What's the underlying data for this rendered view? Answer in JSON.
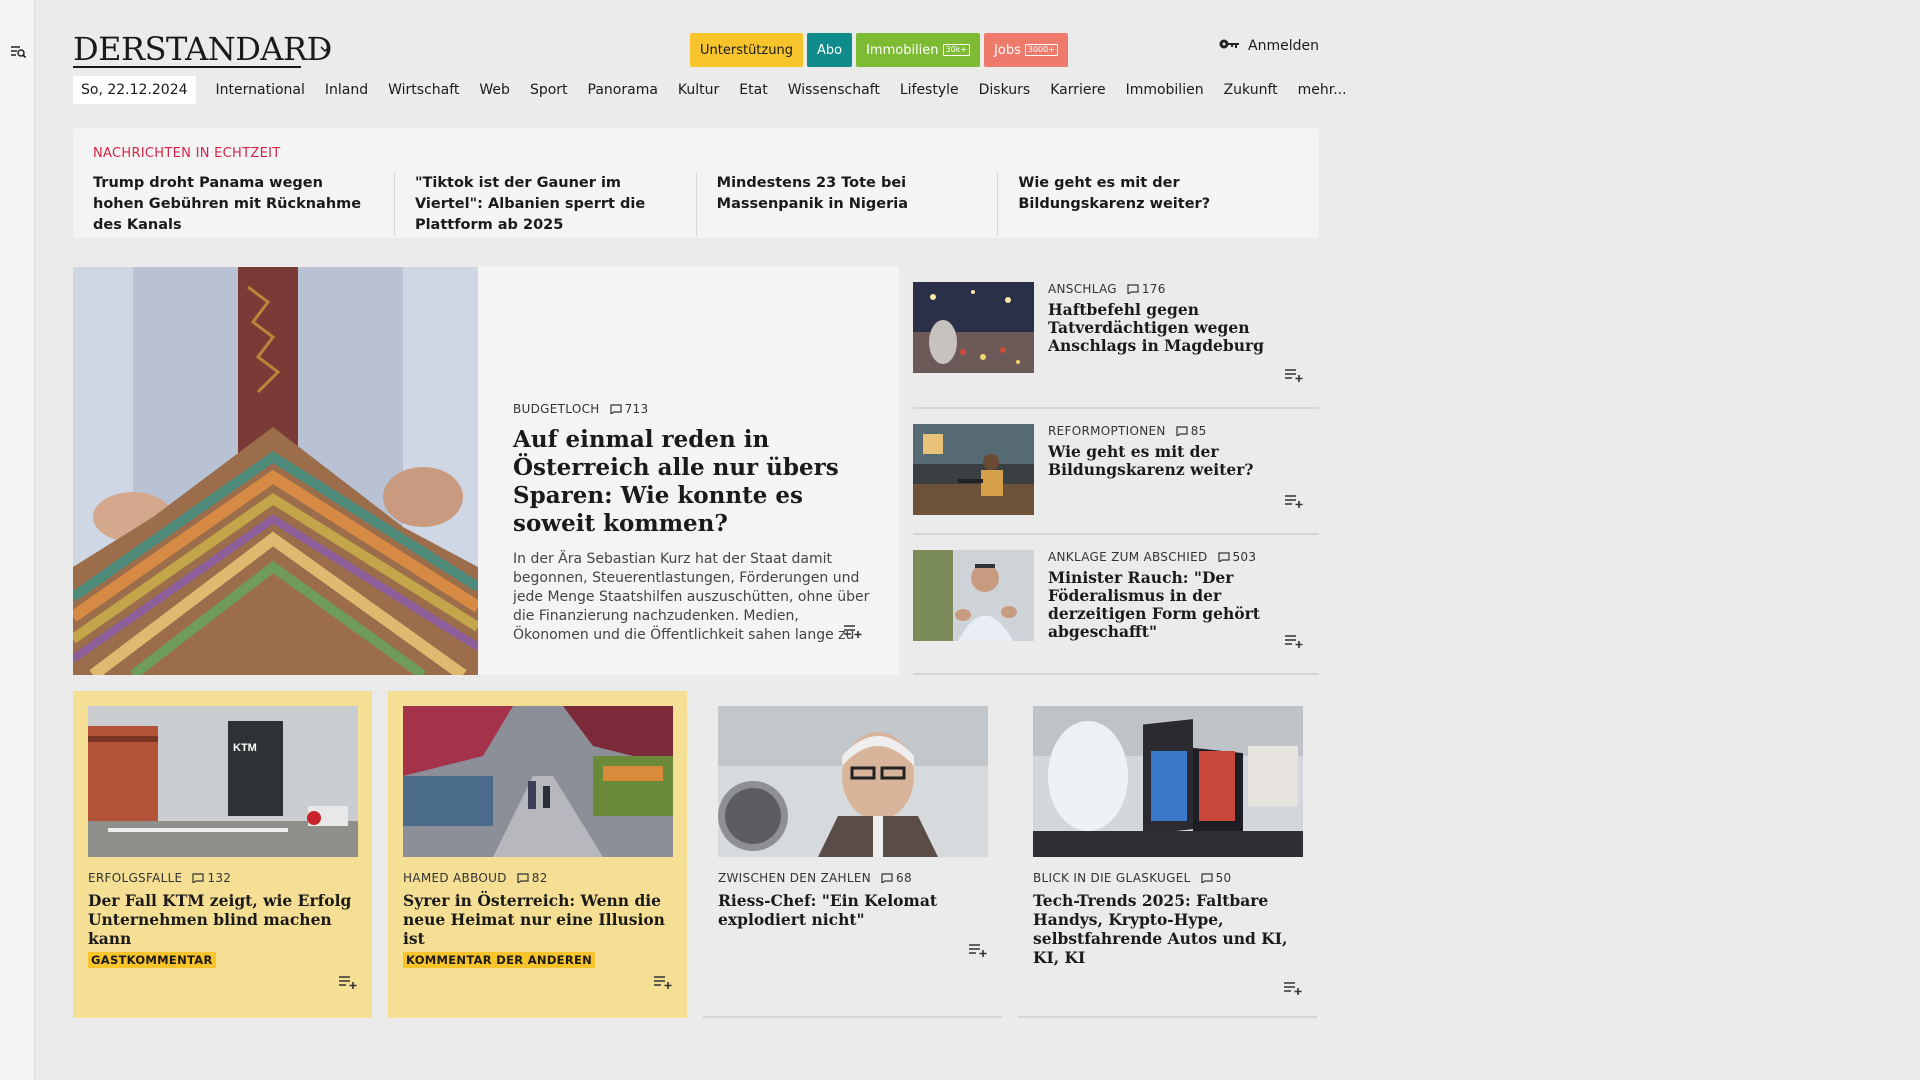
{
  "rail": {
    "icon": "search-menu-icon"
  },
  "header": {
    "logo": "DERSTANDARD",
    "pills": {
      "support": "Unterstützung",
      "abo": "Abo",
      "immo": "Immobilien",
      "immo_badge": "30k+",
      "jobs": "Jobs",
      "jobs_badge": "3000+"
    },
    "login": "Anmelden"
  },
  "nav": {
    "date": "So, 22.12.2024",
    "items": [
      "International",
      "Inland",
      "Wirtschaft",
      "Web",
      "Sport",
      "Panorama",
      "Kultur",
      "Etat",
      "Wissenschaft",
      "Lifestyle",
      "Diskurs",
      "Karriere",
      "Immobilien",
      "Zukunft",
      "mehr..."
    ]
  },
  "ticker": {
    "label": "NACHRICHTEN IN ECHTZEIT",
    "items": [
      "Trump droht Panama wegen hohen Gebühren mit Rücknahme des Kanals",
      "\"Tiktok ist der Gauner im Viertel\": Albanien sperrt die Plattform ab 2025",
      "Mindestens 23 Tote bei Massenpanik in Nigeria",
      "Wie geht es mit der Bildungskarenz weiter?"
    ]
  },
  "lead": {
    "kicker": "BUDGETLOCH",
    "comments": "713",
    "title": "Auf einmal reden in Österreich alle nur übers Sparen: Wie konnte es soweit kommen?",
    "teaser": "In der Ära Sebastian Kurz hat der Staat damit begonnen, Steuerentlastungen, Förderungen und jede Menge Staatshilfen auszuschütten, ohne über die Finanzierung nachzudenken. Medien, Ökonomen und die Öffentlichkeit sahen lange zu"
  },
  "side": [
    {
      "kicker": "ANSCHLAG",
      "comments": "176",
      "title": "Haftbefehl gegen Tatverdächtigen wegen Anschlags in Magdeburg"
    },
    {
      "kicker": "REFORMOPTIONEN",
      "comments": "85",
      "title": "Wie geht es mit der Bildungskarenz weiter?"
    },
    {
      "kicker": "ANKLAGE ZUM ABSCHIED",
      "comments": "503",
      "title": "Minister Rauch: \"Der Föderalismus in der derzeitigen Form gehört abgeschafft\""
    }
  ],
  "cards": [
    {
      "kicker": "ERFOLGSFALLE",
      "comments": "132",
      "title": "Der Fall KTM zeigt, wie Erfolg Unternehmen blind machen kann",
      "tag": "GASTKOMMENTAR",
      "image_sign": "KTM"
    },
    {
      "kicker": "HAMED ABBOUD",
      "comments": "82",
      "title": "Syrer in Österreich: Wenn die neue Heimat nur eine Illusion ist",
      "tag": "KOMMENTAR DER ANDEREN"
    },
    {
      "kicker": "ZWISCHEN DEN ZAHLEN",
      "comments": "68",
      "title": "Riess-Chef: \"Ein Kelomat explodiert nicht\""
    },
    {
      "kicker": "BLICK IN DIE GLASKUGEL",
      "comments": "50",
      "title": "Tech-Trends 2025: Faltbare Handys, Krypto-Hype, selbstfahrende Autos und KI, KI, KI"
    }
  ],
  "colors": {
    "ticker_label": "#d6254a",
    "tag": "#f7c42c",
    "yellow_card": "#f5df95",
    "abo": "#0e8b8a",
    "immo": "#7dbb33",
    "jobs": "#ee7a6b"
  }
}
